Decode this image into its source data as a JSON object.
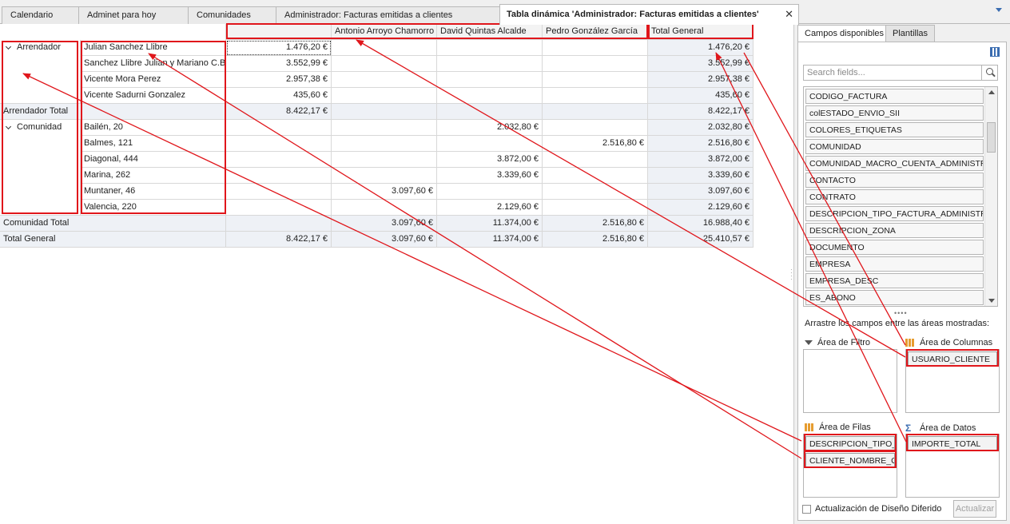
{
  "tabs": [
    {
      "label": "Calendario"
    },
    {
      "label": "Adminet para hoy"
    },
    {
      "label": "Comunidades"
    },
    {
      "label": "Administrador: Facturas emitidas a clientes"
    },
    {
      "label": "Tabla dinámica 'Administrador: Facturas emitidas a clientes'",
      "active": true
    }
  ],
  "close_glyph": "✕",
  "pivot": {
    "columns": [
      "",
      "Antonio Arroyo Chamorro",
      "David Quintas Alcalde",
      "Pedro González García",
      "Total General"
    ],
    "groups": [
      {
        "label": "Arrendador",
        "rows": [
          {
            "label": "Julian Sanchez Llibre",
            "values": [
              "1.476,20 €",
              "",
              "",
              "",
              "1.476,20 €"
            ]
          },
          {
            "label": "Sanchez Llibre Julian y Mariano C.B.",
            "values": [
              "3.552,99 €",
              "",
              "",
              "",
              "3.552,99 €"
            ]
          },
          {
            "label": "Vicente Mora Perez",
            "values": [
              "2.957,38 €",
              "",
              "",
              "",
              "2.957,38 €"
            ]
          },
          {
            "label": "Vicente Sadurni Gonzalez",
            "values": [
              "435,60 €",
              "",
              "",
              "",
              "435,60 €"
            ]
          }
        ],
        "total": {
          "label": "Arrendador Total",
          "values": [
            "8.422,17 €",
            "",
            "",
            "",
            "8.422,17 €"
          ]
        }
      },
      {
        "label": "Comunidad",
        "rows": [
          {
            "label": "Bailén, 20",
            "values": [
              "",
              "",
              "2.032,80 €",
              "",
              "2.032,80 €"
            ]
          },
          {
            "label": "Balmes, 121",
            "values": [
              "",
              "",
              "",
              "2.516,80 €",
              "2.516,80 €"
            ]
          },
          {
            "label": "Diagonal, 444",
            "values": [
              "",
              "",
              "3.872,00 €",
              "",
              "3.872,00 €"
            ]
          },
          {
            "label": "Marina, 262",
            "values": [
              "",
              "",
              "3.339,60 €",
              "",
              "3.339,60 €"
            ]
          },
          {
            "label": "Muntaner, 46",
            "values": [
              "",
              "3.097,60 €",
              "",
              "",
              "3.097,60 €"
            ]
          },
          {
            "label": "Valencia, 220",
            "values": [
              "",
              "",
              "2.129,60 €",
              "",
              "2.129,60 €"
            ]
          }
        ],
        "total": {
          "label": "Comunidad Total",
          "values": [
            "",
            "3.097,60 €",
            "11.374,00 €",
            "2.516,80 €",
            "16.988,40 €"
          ]
        }
      }
    ],
    "grand_total": {
      "label": "Total General",
      "values": [
        "8.422,17 €",
        "3.097,60 €",
        "11.374,00 €",
        "2.516,80 €",
        "25.410,57 €"
      ]
    }
  },
  "panel": {
    "tabs": [
      "Campos disponibles",
      "Plantillas"
    ],
    "search_placeholder": "Search fields...",
    "fields": [
      "CODIGO_FACTURA",
      "colESTADO_ENVIO_SII",
      "COLORES_ETIQUETAS",
      "COMUNIDAD",
      "COMUNIDAD_MACRO_CUENTA_ADMINISTRACION",
      "CONTACTO",
      "CONTRATO",
      "DESCRIPCION_TIPO_FACTURA_ADMINISTRACION",
      "DESCRIPCION_ZONA",
      "DOCUMENTO",
      "EMPRESA",
      "EMPRESA_DESC",
      "ES_ABONO"
    ],
    "splitter": "••••",
    "hint": "Arrastre los campos entre las áreas mostradas:",
    "areas": {
      "filter": {
        "label": "Área de Filtro",
        "fields": []
      },
      "columns": {
        "label": "Área de Columnas",
        "fields": [
          "USUARIO_CLIENTE"
        ]
      },
      "rows": {
        "label": "Área de Filas",
        "fields": [
          "DESCRIPCION_TIPO_CLIENTE",
          "CLIENTE_NOMBRE_COMPLETO"
        ]
      },
      "data": {
        "label": "Área de Datos",
        "fields": [
          "IMPORTE_TOTAL"
        ]
      }
    },
    "defer_label": "Actualización de Diseño Diferido",
    "apply_label": "Actualizar"
  },
  "colors": {
    "annotation": "#e0161b",
    "accent": "#3b6db1"
  }
}
